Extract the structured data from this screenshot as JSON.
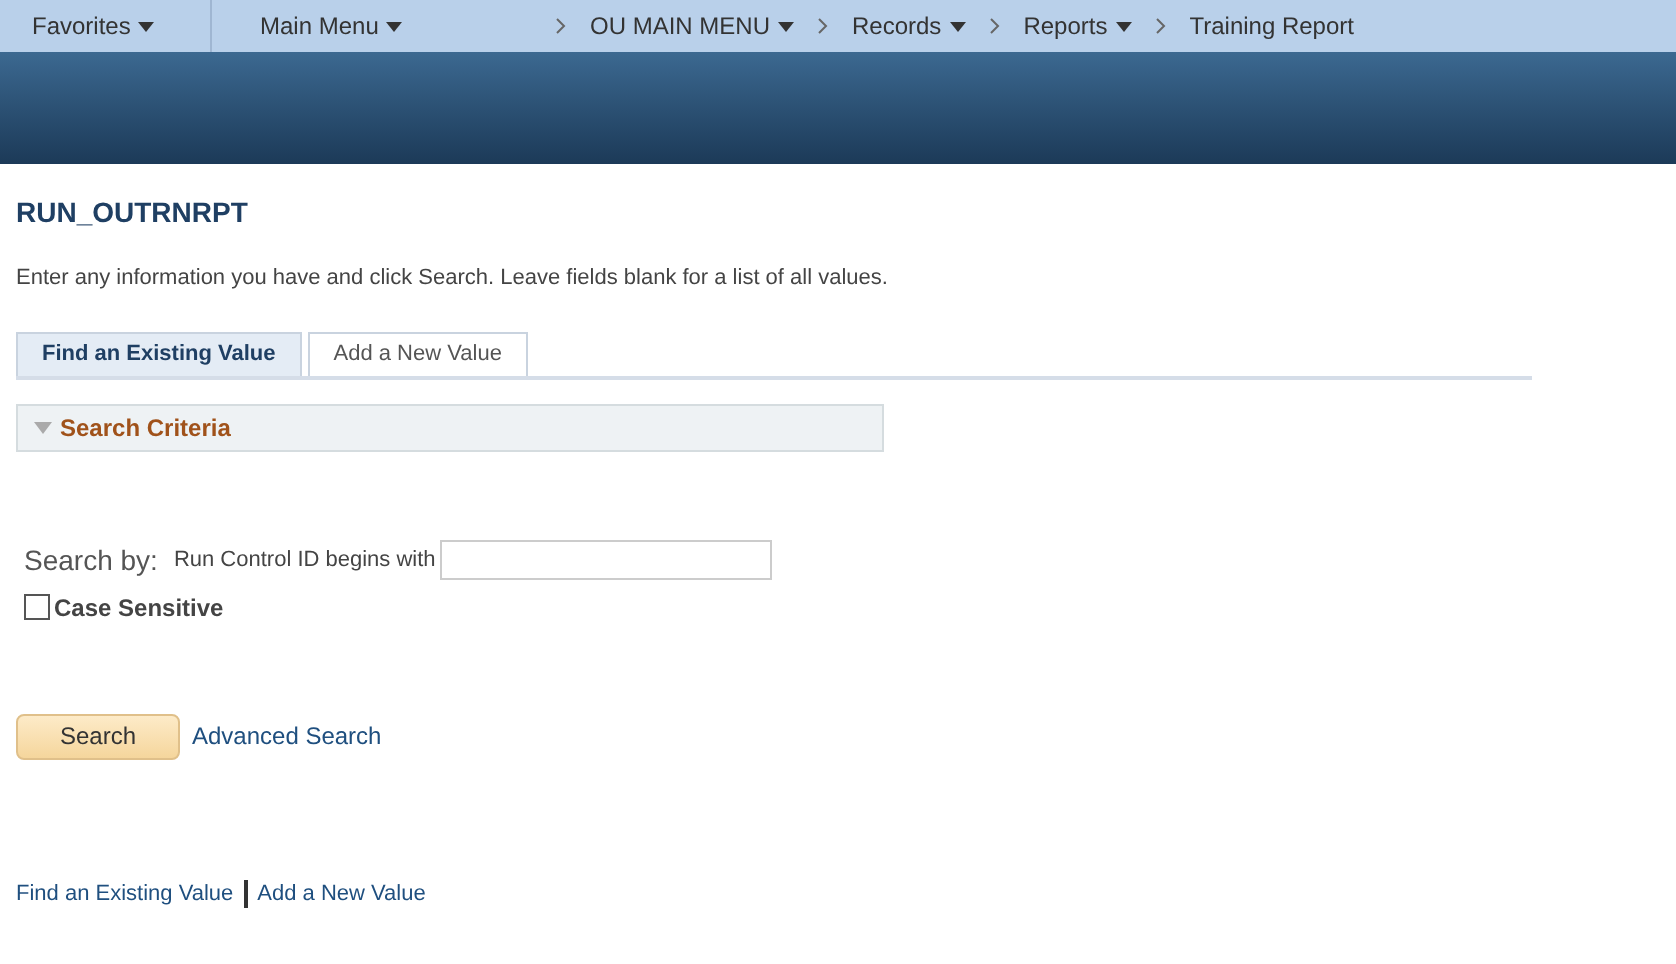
{
  "nav": {
    "menus": [
      {
        "label": "Favorites",
        "dropdown": true
      },
      {
        "label": "Main Menu",
        "dropdown": true
      }
    ],
    "breadcrumbs": [
      {
        "label": "OU MAIN MENU",
        "dropdown": true
      },
      {
        "label": "Records",
        "dropdown": true
      },
      {
        "label": "Reports",
        "dropdown": true
      },
      {
        "label": "Training Report",
        "dropdown": false
      }
    ]
  },
  "page": {
    "title": "RUN_OUTRNRPT",
    "instructions": "Enter any information you have and click Search. Leave fields blank for a list of all values."
  },
  "tabs": [
    {
      "label": "Find an Existing Value",
      "selected": true
    },
    {
      "label": "Add a New Value",
      "selected": false
    }
  ],
  "search_criteria": {
    "title": "Search Criteria",
    "expanded": true,
    "search_by_label": "Search by:",
    "field_label": "Run Control ID begins with",
    "case_sensitive": {
      "label": "Case Sensitive",
      "checked": false
    }
  },
  "actions": {
    "search_button": "Search",
    "advanced_search_link": "Advanced Search"
  },
  "footer_links": [
    "Find an Existing Value",
    "Add a New Value"
  ]
}
